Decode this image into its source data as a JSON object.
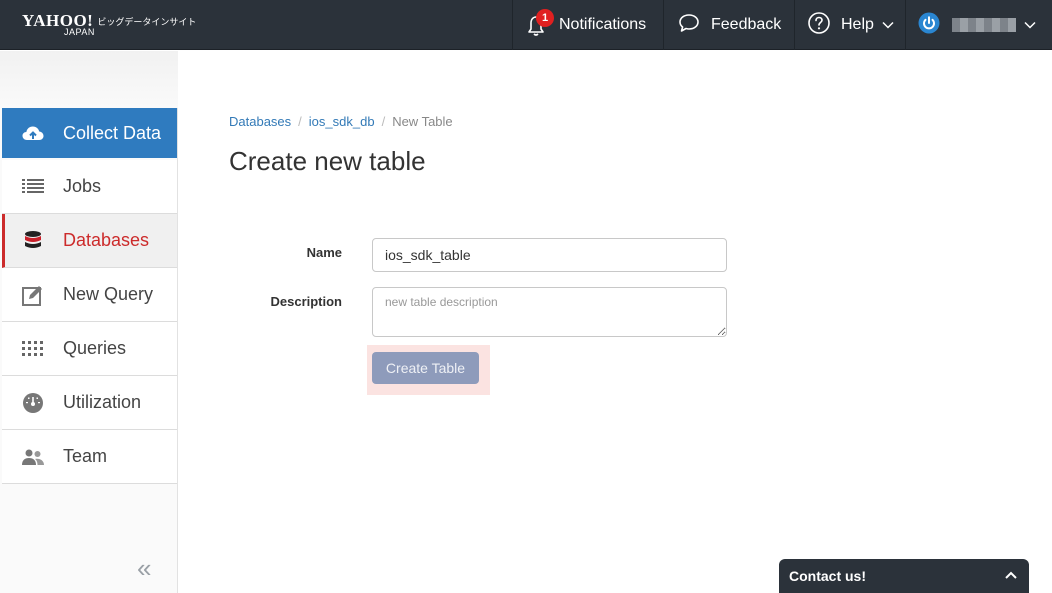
{
  "header": {
    "logo_text": "YAHOO!",
    "logo_sub": "JAPAN",
    "logo_tagline": "ビッグデータインサイト",
    "notifications_label": "Notifications",
    "notifications_count": "1",
    "feedback_label": "Feedback",
    "help_label": "Help"
  },
  "sidebar": {
    "items": [
      {
        "label": "Collect Data",
        "icon": "cloud-upload-icon"
      },
      {
        "label": "Jobs",
        "icon": "list-icon"
      },
      {
        "label": "Databases",
        "icon": "database-icon"
      },
      {
        "label": "New Query",
        "icon": "edit-icon"
      },
      {
        "label": "Queries",
        "icon": "grid-icon"
      },
      {
        "label": "Utilization",
        "icon": "gauge-icon"
      },
      {
        "label": "Team",
        "icon": "users-icon"
      }
    ],
    "collapse_glyph": "«"
  },
  "breadcrumb": {
    "items": [
      "Databases",
      "ios_sdk_db",
      "New Table"
    ],
    "separator": "/"
  },
  "page_title": "Create new table",
  "form": {
    "name_label": "Name",
    "name_value": "ios_sdk_table",
    "description_label": "Description",
    "description_placeholder": "new table description",
    "submit_label": "Create Table"
  },
  "contact": {
    "label": "Contact us!"
  },
  "colors": {
    "topbar": "#2b323a",
    "primary": "#2f7bbf",
    "active": "#cc2b2b",
    "button": "#8e9bbb",
    "badge": "#e02020"
  }
}
